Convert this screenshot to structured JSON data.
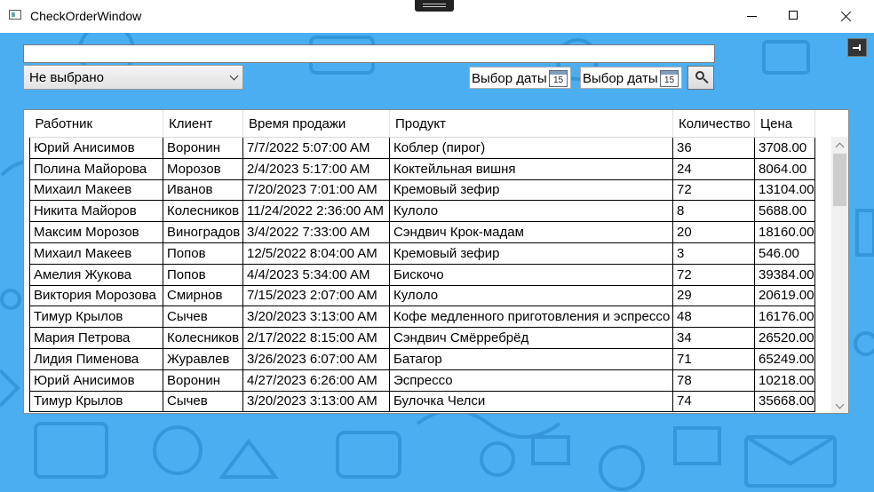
{
  "window": {
    "title": "CheckOrderWindow"
  },
  "filters": {
    "search_value": "",
    "combo_value": "Не выбрано",
    "date_from_label": "Выбор даты",
    "date_to_label": "Выбор даты",
    "calendar_day": "15"
  },
  "grid": {
    "columns": [
      "Работник",
      "Клиент",
      "Время продажи",
      "Продукт",
      "Количество",
      "Цена"
    ],
    "rows": [
      [
        "Юрий Анисимов",
        "Воронин",
        "7/7/2022 5:07:00 AM",
        "Коблер (пирог)",
        "36",
        "3708.00"
      ],
      [
        "Полина Майорова",
        "Морозов",
        "2/4/2023 5:17:00 AM",
        "Коктейльная вишня",
        "24",
        "8064.00"
      ],
      [
        "Михаил Макеев",
        "Иванов",
        "7/20/2023 7:01:00 AM",
        "Кремовый зефир",
        "72",
        "13104.00"
      ],
      [
        "Никита Майоров",
        "Колесников",
        "11/24/2022 2:36:00 AM",
        "Кулоло",
        "8",
        "5688.00"
      ],
      [
        "Максим Морозов",
        "Виноградов",
        "3/4/2022 7:33:00 AM",
        "Сэндвич Крок-мадам",
        "20",
        "18160.00"
      ],
      [
        "Михаил Макеев",
        "Попов",
        "12/5/2022 8:04:00 AM",
        "Кремовый зефир",
        "3",
        "546.00"
      ],
      [
        "Амелия Жукова",
        "Попов",
        "4/4/2023 5:34:00 AM",
        "Бискочо",
        "72",
        "39384.00"
      ],
      [
        "Виктория Морозова",
        "Смирнов",
        "7/15/2023 2:07:00 AM",
        "Кулоло",
        "29",
        "20619.00"
      ],
      [
        "Тимур Крылов",
        "Сычев",
        "3/20/2023 3:13:00 AM",
        "Кофе медленного приготовления и эспрессо",
        "48",
        "16176.00"
      ],
      [
        "Мария Петрова",
        "Колесников",
        "2/17/2022 8:15:00 AM",
        "Сэндвич Смёрребрёд",
        "34",
        "26520.00"
      ],
      [
        "Лидия Пименова",
        "Журавлев",
        "3/26/2023 6:07:00 AM",
        "Батагор",
        "71",
        "65249.00"
      ],
      [
        "Юрий Анисимов",
        "Воронин",
        "4/27/2023 6:26:00 AM",
        "Эспрессо",
        "78",
        "10218.00"
      ],
      [
        "Тимур Крылов",
        "Сычев",
        "3/20/2023 3:13:00 AM",
        "Булочка Челси",
        "74",
        "35668.00"
      ]
    ]
  }
}
